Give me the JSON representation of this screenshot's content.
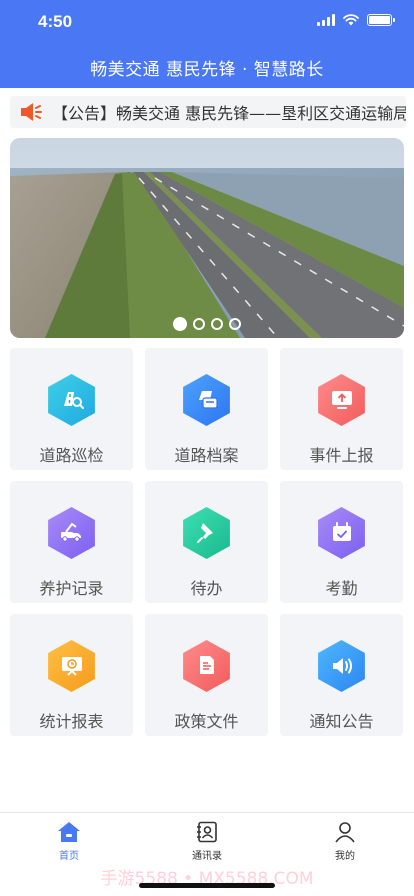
{
  "status_bar": {
    "time": "4:50"
  },
  "header": {
    "title": "畅美交通 惠民先锋 · 智慧路长"
  },
  "notice": {
    "text": "【公告】畅美交通 惠民先锋——垦利区交通运输局"
  },
  "banner": {
    "slide_count": 4,
    "active_index": 0
  },
  "menu": [
    {
      "label": "道路巡检",
      "icon": "road-inspection-icon",
      "color_a": "#3fd0e8",
      "color_b": "#1fa8e0"
    },
    {
      "label": "道路档案",
      "icon": "road-archive-icon",
      "color_a": "#4fa3ff",
      "color_b": "#2b74f0"
    },
    {
      "label": "事件上报",
      "icon": "event-report-icon",
      "color_a": "#ff8c8c",
      "color_b": "#f25a5a"
    },
    {
      "label": "养护记录",
      "icon": "maintenance-truck-icon",
      "color_a": "#a98cf8",
      "color_b": "#7a5ef0"
    },
    {
      "label": "待办",
      "icon": "pin-icon",
      "color_a": "#3fe0b4",
      "color_b": "#18b88e"
    },
    {
      "label": "考勤",
      "icon": "calendar-check-icon",
      "color_a": "#a98cf8",
      "color_b": "#7a5ef0"
    },
    {
      "label": "统计报表",
      "icon": "report-board-icon",
      "color_a": "#ffc044",
      "color_b": "#f59a1c"
    },
    {
      "label": "政策文件",
      "icon": "document-icon",
      "color_a": "#ff8c8c",
      "color_b": "#f25a5a"
    },
    {
      "label": "通知公告",
      "icon": "speaker-icon",
      "color_a": "#4fb8ff",
      "color_b": "#2b84f0"
    }
  ],
  "tabbar": {
    "items": [
      {
        "label": "首页",
        "icon": "home-icon",
        "active": true
      },
      {
        "label": "通讯录",
        "icon": "contacts-icon",
        "active": false
      },
      {
        "label": "我的",
        "icon": "user-icon",
        "active": false
      }
    ]
  },
  "watermark": "手游5588 • MX5588.COM",
  "colors": {
    "brand": "#4a78f5",
    "tile_bg": "#f3f4f7",
    "notice_icon": "#f05a28"
  }
}
